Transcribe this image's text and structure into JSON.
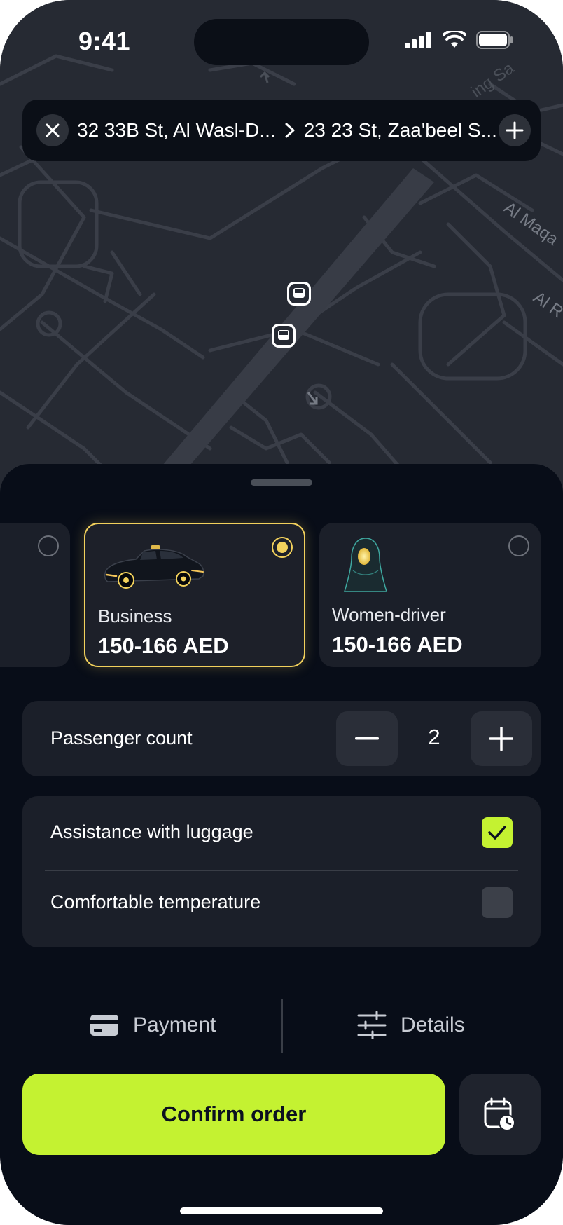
{
  "status_bar": {
    "time": "9:41"
  },
  "route": {
    "from": "32 33B St, Al Wasl-D...",
    "to": "23 23 St, Zaa'beel S..."
  },
  "map": {
    "street_labels": [
      "Al Maqa",
      "Al R"
    ],
    "partial_label": "ing Sa"
  },
  "tariffs": [
    {
      "name": "",
      "price": "",
      "selected": false
    },
    {
      "name": "Business",
      "price": "150-166 AED",
      "selected": true
    },
    {
      "name": "Women-driver",
      "price": "150-166 AED",
      "selected": false
    }
  ],
  "passengers": {
    "label": "Passenger count",
    "count": "2"
  },
  "options": [
    {
      "label": "Assistance with luggage",
      "checked": true
    },
    {
      "label": "Comfortable temperature",
      "checked": false
    }
  ],
  "actions": {
    "payment_label": "Payment",
    "details_label": "Details"
  },
  "confirm": {
    "label": "Confirm order"
  },
  "colors": {
    "accent": "#c4f231",
    "selected_border": "#f2d15c",
    "sheet_bg": "#080d18",
    "card_bg": "#1b1f29",
    "map_bg": "#262a33"
  }
}
